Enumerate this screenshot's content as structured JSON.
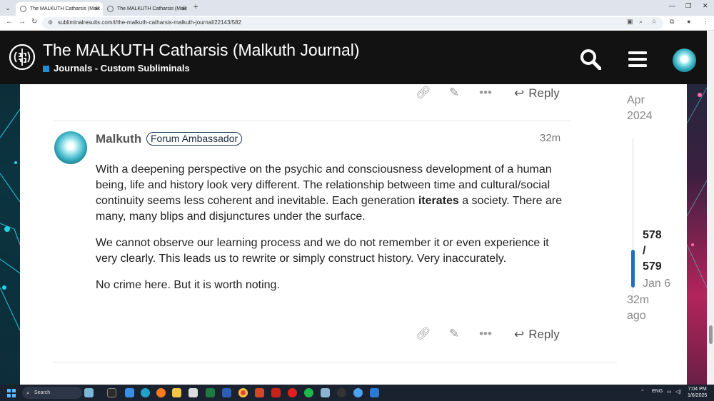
{
  "browser": {
    "tabs": [
      {
        "title": "The MALKUTH Catharsis (Malk",
        "active": true
      },
      {
        "title": "The MALKUTH Catharsis (Malk",
        "active": false
      }
    ],
    "url": "subliminalresults.com/t/the-malkuth-catharsis-malkuth-journal/22143/582"
  },
  "header": {
    "title": "The MALKUTH Catharsis (Malkuth Journal)",
    "category": "Journals - Custom Subliminals",
    "category_color": "#1e8fd6"
  },
  "prev_post": {
    "actions": {
      "reply_label": "Reply"
    }
  },
  "post": {
    "username": "Malkuth",
    "badge": "Forum Ambassador",
    "time": "32m",
    "paragraphs": {
      "p1_a": "With a deepening perspective on the psychic and consciousness development of a human being, life and history look very different. The relationship between time and cultural/social continuity seems less coherent and inevitable. Each generation ",
      "p1_strong": "iterates",
      "p1_b": " a society. There are many, many blips and disjunctures under the surface.",
      "p2": "We cannot observe our learning process and we do not remember it or even experience it very clearly. This leads us to rewrite or simply construct history. Very inaccurately.",
      "p3": "No crime here. But it is worth noting."
    },
    "reply_label": "Reply"
  },
  "timeline": {
    "start_month": "Apr",
    "start_year": "2024",
    "position": "578",
    "separator": "/",
    "total": "579",
    "end_label": "Jan 6",
    "last_activity": "32m ago"
  },
  "taskbar": {
    "search_label": "Search",
    "lang": "ENG",
    "time": "7:04 PM",
    "date": "1/6/2025"
  }
}
